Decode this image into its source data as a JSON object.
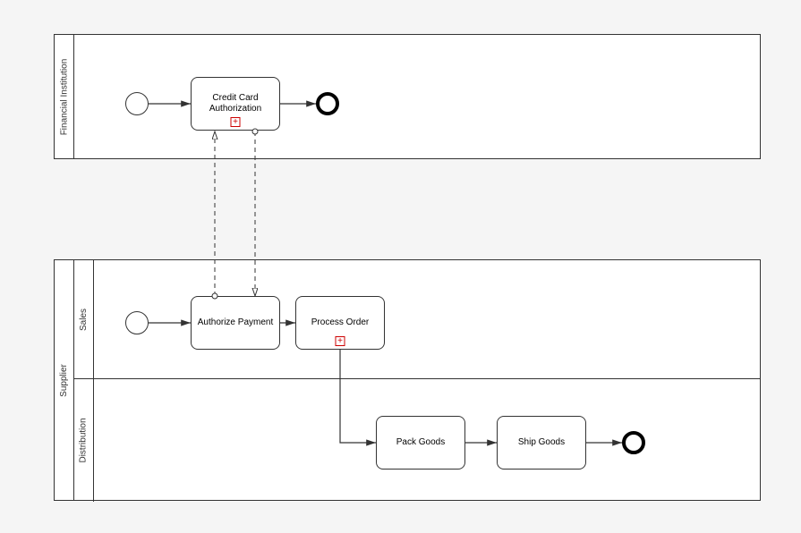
{
  "chart_data": {
    "type": "diagram",
    "notation": "BPMN",
    "pools": [
      {
        "name": "Financial Institution",
        "lanes": [
          {
            "name": null,
            "elements": [
              {
                "id": "start1",
                "type": "start-event"
              },
              {
                "id": "t_cc",
                "type": "task",
                "label": "Credit Card Authorization",
                "marker": "subprocess"
              },
              {
                "id": "end1",
                "type": "end-event"
              }
            ]
          }
        ]
      },
      {
        "name": "Supplier",
        "lanes": [
          {
            "name": "Sales",
            "elements": [
              {
                "id": "start2",
                "type": "start-event"
              },
              {
                "id": "t_auth",
                "type": "task",
                "label": "Authorize Payment"
              },
              {
                "id": "t_proc",
                "type": "task",
                "label": "Process Order",
                "marker": "subprocess"
              }
            ]
          },
          {
            "name": "Distribution",
            "elements": [
              {
                "id": "t_pack",
                "type": "task",
                "label": "Pack Goods"
              },
              {
                "id": "t_ship",
                "type": "task",
                "label": "Ship Goods"
              },
              {
                "id": "end2",
                "type": "end-event"
              }
            ]
          }
        ]
      }
    ],
    "sequence_flows": [
      {
        "from": "start1",
        "to": "t_cc"
      },
      {
        "from": "t_cc",
        "to": "end1"
      },
      {
        "from": "start2",
        "to": "t_auth"
      },
      {
        "from": "t_auth",
        "to": "t_proc"
      },
      {
        "from": "t_proc",
        "to": "t_pack"
      },
      {
        "from": "t_pack",
        "to": "t_ship"
      },
      {
        "from": "t_ship",
        "to": "end2"
      }
    ],
    "message_flows": [
      {
        "from": "t_auth",
        "to": "t_cc"
      },
      {
        "from": "t_cc",
        "to": "t_auth"
      }
    ]
  },
  "labels": {
    "pool_financial": "Financial Institution",
    "pool_supplier": "Supplier",
    "lane_sales": "Sales",
    "lane_distribution": "Distribution",
    "task_cc": "Credit Card Authorization",
    "task_auth": "Authorize Payment",
    "task_proc": "Process Order",
    "task_pack": "Pack Goods",
    "task_ship": "Ship Goods",
    "plus": "+"
  }
}
